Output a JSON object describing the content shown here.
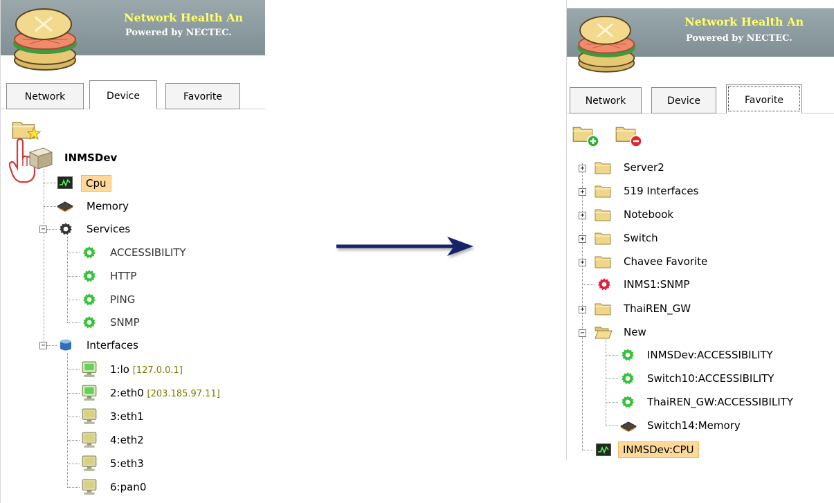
{
  "banner": {
    "title": "Network Health An",
    "subtitle": "Powered by NECTEC."
  },
  "tabs": {
    "network": "Network",
    "device": "Device",
    "favorite": "Favorite"
  },
  "left_tree": {
    "root": "INMSDev",
    "cpu": "Cpu",
    "memory": "Memory",
    "services": "Services",
    "service_items": [
      "ACCESSIBILITY",
      "HTTP",
      "PING",
      "SNMP"
    ],
    "interfaces": "Interfaces",
    "interface_items": [
      {
        "name": "1:lo",
        "ip": "[127.0.0.1]"
      },
      {
        "name": "2:eth0",
        "ip": "[203.185.97.11]"
      },
      {
        "name": "3:eth1",
        "ip": ""
      },
      {
        "name": "4:eth2",
        "ip": ""
      },
      {
        "name": "5:eth3",
        "ip": ""
      },
      {
        "name": "6:pan0",
        "ip": ""
      }
    ]
  },
  "right_tree": {
    "items": [
      "Server2",
      "519 Interfaces",
      "Notebook",
      "Switch",
      "Chavee Favorite",
      "INMS1:SNMP",
      "ThaiREN_GW",
      "New",
      "INMSDev:ACCESSIBILITY",
      "Switch10:ACCESSIBILITY",
      "ThaiREN_GW:ACCESSIBILITY",
      "Switch14:Memory",
      "INMSDev:CPU"
    ]
  },
  "colors": {
    "arrow": "#15206b",
    "selection": "#ffd99a",
    "service_ok": "#35c23b",
    "service_down": "#e0203a"
  }
}
